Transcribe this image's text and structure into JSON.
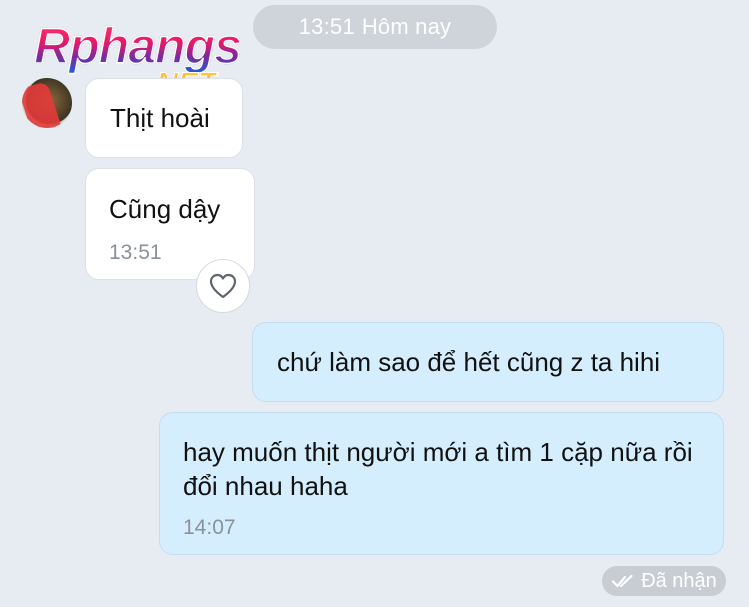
{
  "header": {
    "time": "13:51",
    "day": "Hôm nay"
  },
  "watermark": {
    "brand": "Rphangs",
    "tld": ".NET"
  },
  "messages": [
    {
      "direction": "incoming",
      "text": "Thịt hoài"
    },
    {
      "direction": "incoming",
      "text": "Cũng dậy",
      "time": "13:51"
    },
    {
      "direction": "outgoing",
      "text": "chứ làm sao để hết cũng z ta hihi"
    },
    {
      "direction": "outgoing",
      "text": "hay muốn thịt người mới a tìm 1 cặp nữa rồi đổi nhau haha",
      "time": "14:07"
    }
  ],
  "reaction": {
    "icon": "heart-outline-icon"
  },
  "status": {
    "icon": "double-check-icon",
    "label": "Đã nhận"
  },
  "colors": {
    "background": "#e7ebf2",
    "incoming_bubble": "#ffffff",
    "outgoing_bubble": "#d5eefe",
    "pill": "#cfd3da",
    "timestamp": "#8a9299"
  }
}
